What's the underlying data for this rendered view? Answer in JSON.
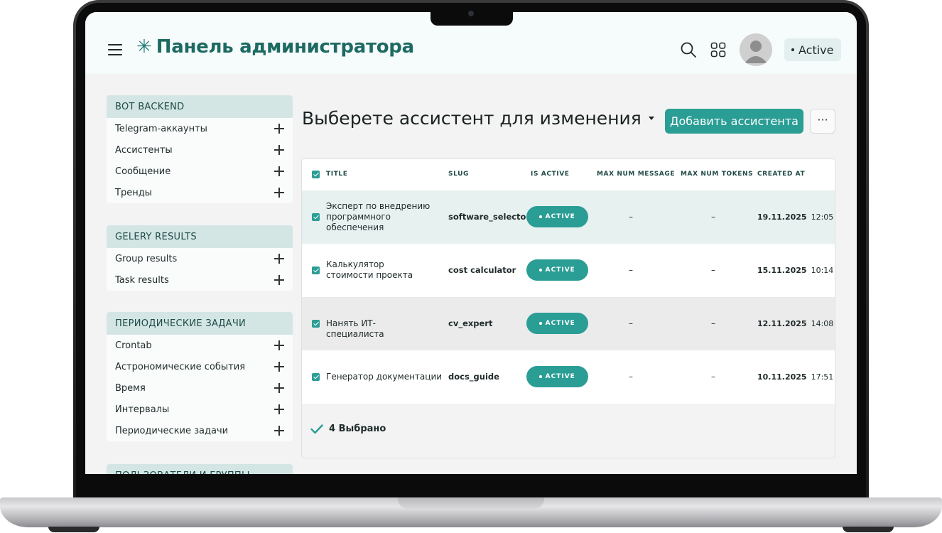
{
  "header": {
    "menu_icon": "hamburger-icon",
    "brand_icon": "asterisk-icon",
    "title": "Панель администратора",
    "search_icon": "search-icon",
    "apps_icon": "apps-grid-icon",
    "status": "Active"
  },
  "sidebar": [
    {
      "heading": "BOT BACKEND",
      "items": [
        "Telegram-аккаунты",
        "Ассистенты",
        "Сообщение",
        "Тренды"
      ]
    },
    {
      "heading": "GELERY RESULTS",
      "items": [
        "Group results",
        "Task results"
      ]
    },
    {
      "heading": "ПЕРИОДИЧЕСКИЕ ЗАДАЧИ",
      "items": [
        "Crontab",
        "Астрономические события",
        "Время",
        "Интервалы",
        "Периодические задачи"
      ]
    },
    {
      "heading": "ПОЛЬЗОВАТЕЛИ И ГРУППЫ",
      "items": []
    }
  ],
  "main": {
    "title": "Выберете ассистент для изменения",
    "add_button": "Добавить ассистента",
    "more_button": "···",
    "columns": {
      "title": "TITLE",
      "slug": "SLUG",
      "is_active": "IS ACTIVE",
      "max_num_message": "MAX NUM MESSAGE",
      "max_num_tokens": "MAX NUM TOKENS",
      "created_at": "CREATED AT"
    },
    "rows": [
      {
        "title": "Эксперт по внедрению программного обеспечения",
        "slug": "software_selector",
        "status": "ACTIVE",
        "max_msg": "–",
        "max_tokens": "–",
        "date": "19.11.2025",
        "time": "12:05",
        "bg": "#e6f1f0"
      },
      {
        "title": "Калькулятор стоимости проекта",
        "slug": "cost calculator",
        "status": "ACTIVE",
        "max_msg": "–",
        "max_tokens": "–",
        "date": "15.11.2025",
        "time": "10:14",
        "bg": "#ffffff"
      },
      {
        "title": "Нанять ИТ-специалиста",
        "slug": "cv_expert",
        "status": "ACTIVE",
        "max_msg": "–",
        "max_tokens": "–",
        "date": "12.11.2025",
        "time": "14:08",
        "bg": "#ebebeb"
      },
      {
        "title": "Генератор документации",
        "slug": "docs_guide",
        "status": "ACTIVE",
        "max_msg": "–",
        "max_tokens": "–",
        "date": "10.11.2025",
        "time": "17:51",
        "bg": "#ffffff"
      }
    ],
    "selected_count": "4 Выбрано"
  },
  "colors": {
    "accent": "#2a9d95",
    "brand_text": "#1d6a62",
    "sidebar_header": "#d3e6e4"
  }
}
